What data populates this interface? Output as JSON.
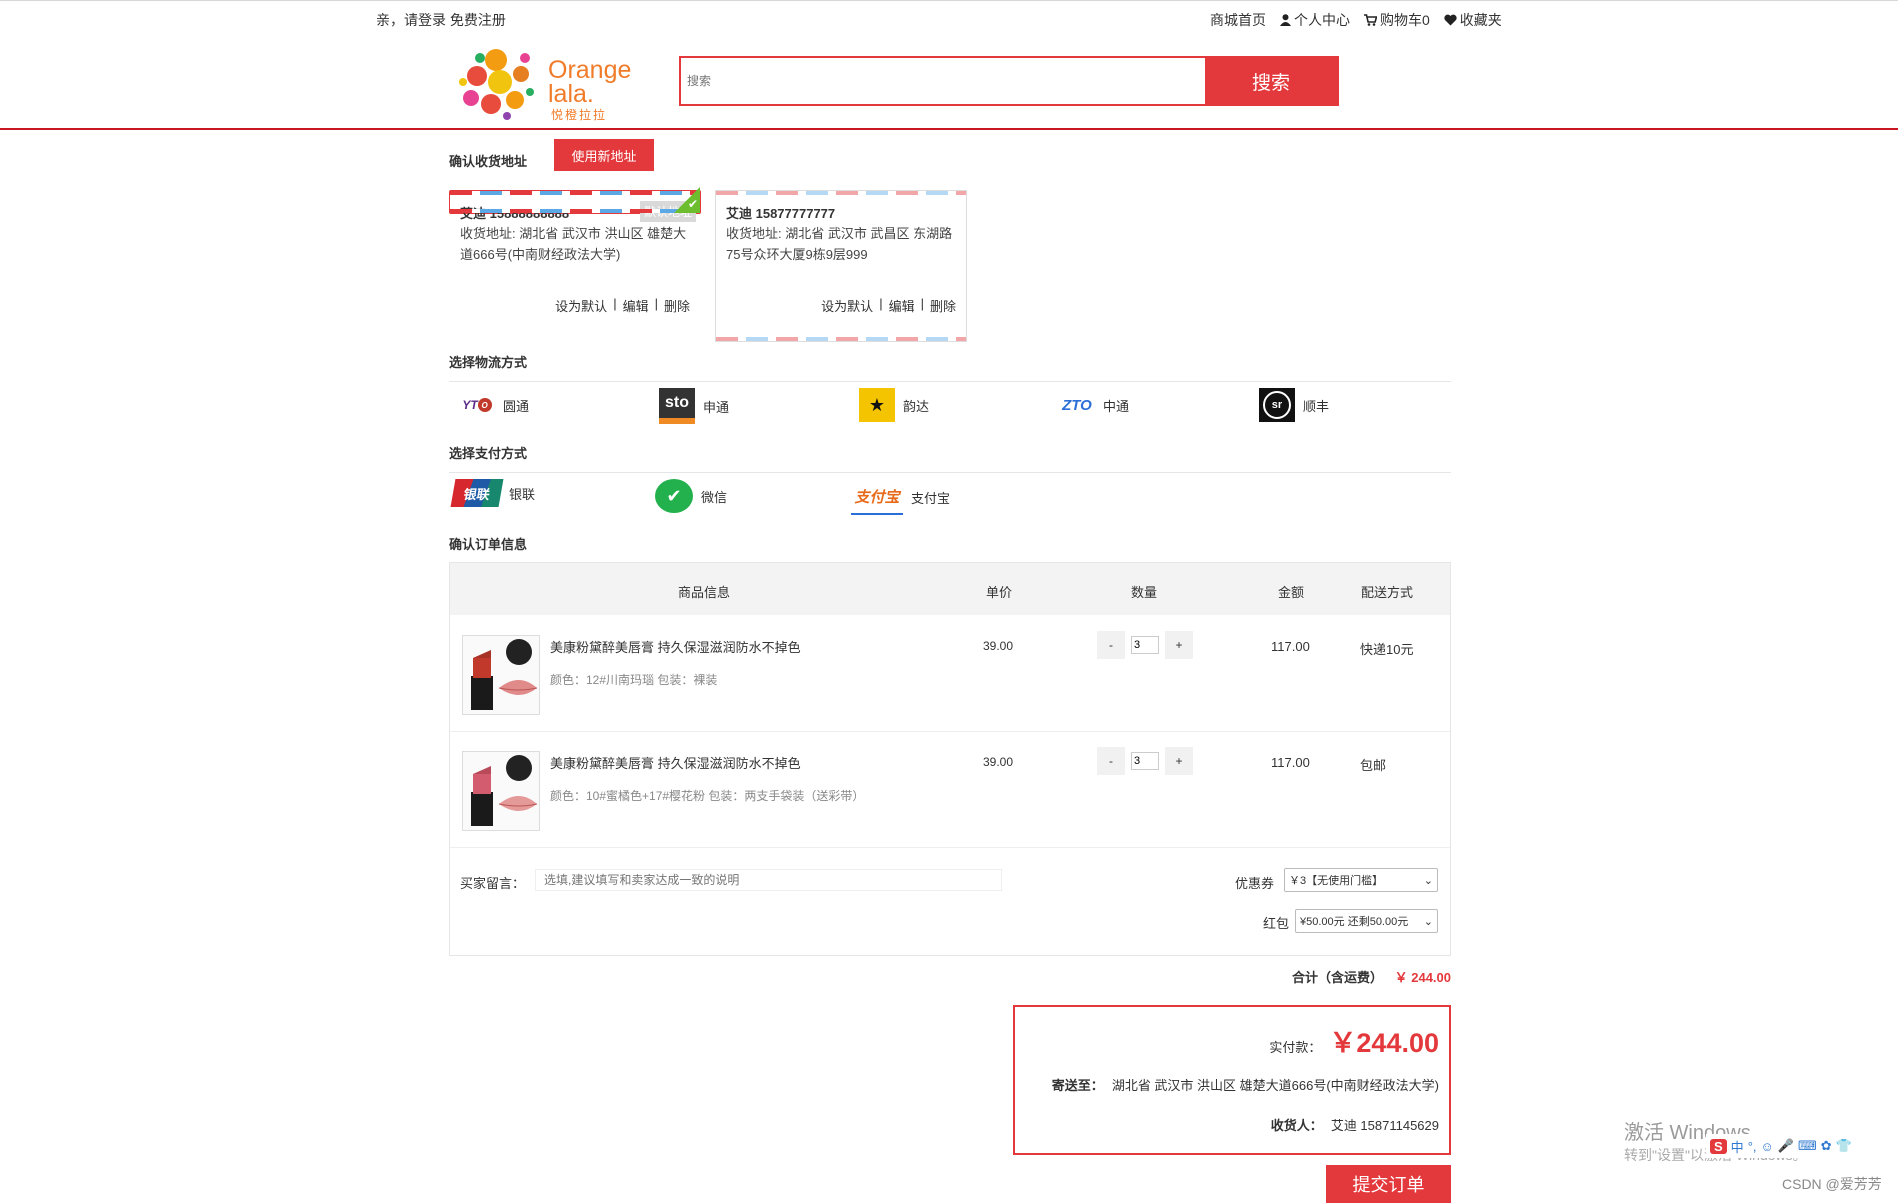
{
  "topbar": {
    "greeting": "亲，请登录",
    "register": "免费注册",
    "links": [
      "商城首页",
      "个人中心",
      "购物车0",
      "收藏夹"
    ]
  },
  "logo": {
    "text_line1": "Orange",
    "text_line2": "lala.",
    "sub": "悦橙拉拉"
  },
  "search": {
    "placeholder": "搜索",
    "button": "搜索"
  },
  "address": {
    "title": "确认收货地址",
    "new_button": "使用新地址",
    "cards": [
      {
        "name": "艾迪 15888888888",
        "default_badge": "默认地址",
        "label": "收货地址:",
        "address": "湖北省 武汉市 洪山区 雄楚大道666号(中南财经政法大学)",
        "ops": [
          "设为默认",
          "编辑",
          "删除"
        ]
      },
      {
        "name": "艾迪 15877777777",
        "label": "收货地址:",
        "address": "湖北省 武汉市 武昌区 东湖路75号众环大厦9栋9层999",
        "ops": [
          "设为默认",
          "编辑",
          "删除"
        ]
      }
    ]
  },
  "logistics": {
    "title": "选择物流方式",
    "options": [
      "圆通",
      "申通",
      "韵达",
      "中通",
      "顺丰"
    ]
  },
  "payment": {
    "title": "选择支付方式",
    "options": [
      "银联",
      "微信",
      "支付宝"
    ]
  },
  "order": {
    "title": "确认订单信息",
    "headers": [
      "商品信息",
      "单价",
      "数量",
      "金额",
      "配送方式"
    ],
    "rows": [
      {
        "name": "美康粉黛醉美唇膏 持久保湿滋润防水不掉色",
        "attrs": "颜色：12#川南玛瑙 包装：裸装",
        "price": "39.00",
        "qty": "3",
        "amount": "117.00",
        "shipping": "快递10元"
      },
      {
        "name": "美康粉黛醉美唇膏 持久保湿滋润防水不掉色",
        "attrs": "颜色：10#蜜橘色+17#樱花粉 包装：两支手袋装（送彩带）",
        "price": "39.00",
        "qty": "3",
        "amount": "117.00",
        "shipping": "包邮"
      }
    ],
    "message_label": "买家留言：",
    "message_placeholder": "选填,建议填写和卖家达成一致的说明",
    "coupon_label": "优惠券",
    "coupon_value": "￥3【无使用门槛】",
    "redpack_label": "红包",
    "redpack_value": "¥50.00元 还剩50.00元"
  },
  "summary": {
    "total_label": "合计（含运费）",
    "total_value": "￥ 244.00",
    "pay_label": "实付款：",
    "pay_value": "￥244.00",
    "ship_to_label": "寄送至：",
    "ship_to": "湖北省 武汉市 洪山区 雄楚大道666号(中南财经政法大学)",
    "receiver_label": "收货人：",
    "receiver": "艾迪 15871145629",
    "submit": "提交订单"
  },
  "overlay": {
    "watermark_line1": "激活 Windows",
    "watermark_line2": "转到\"设置\"以激活 Windows。",
    "csdn": "CSDN @爱芳芳",
    "ime": "中"
  },
  "colors": {
    "accent": "#e4393c",
    "brand_orange": "#f07c2a"
  }
}
